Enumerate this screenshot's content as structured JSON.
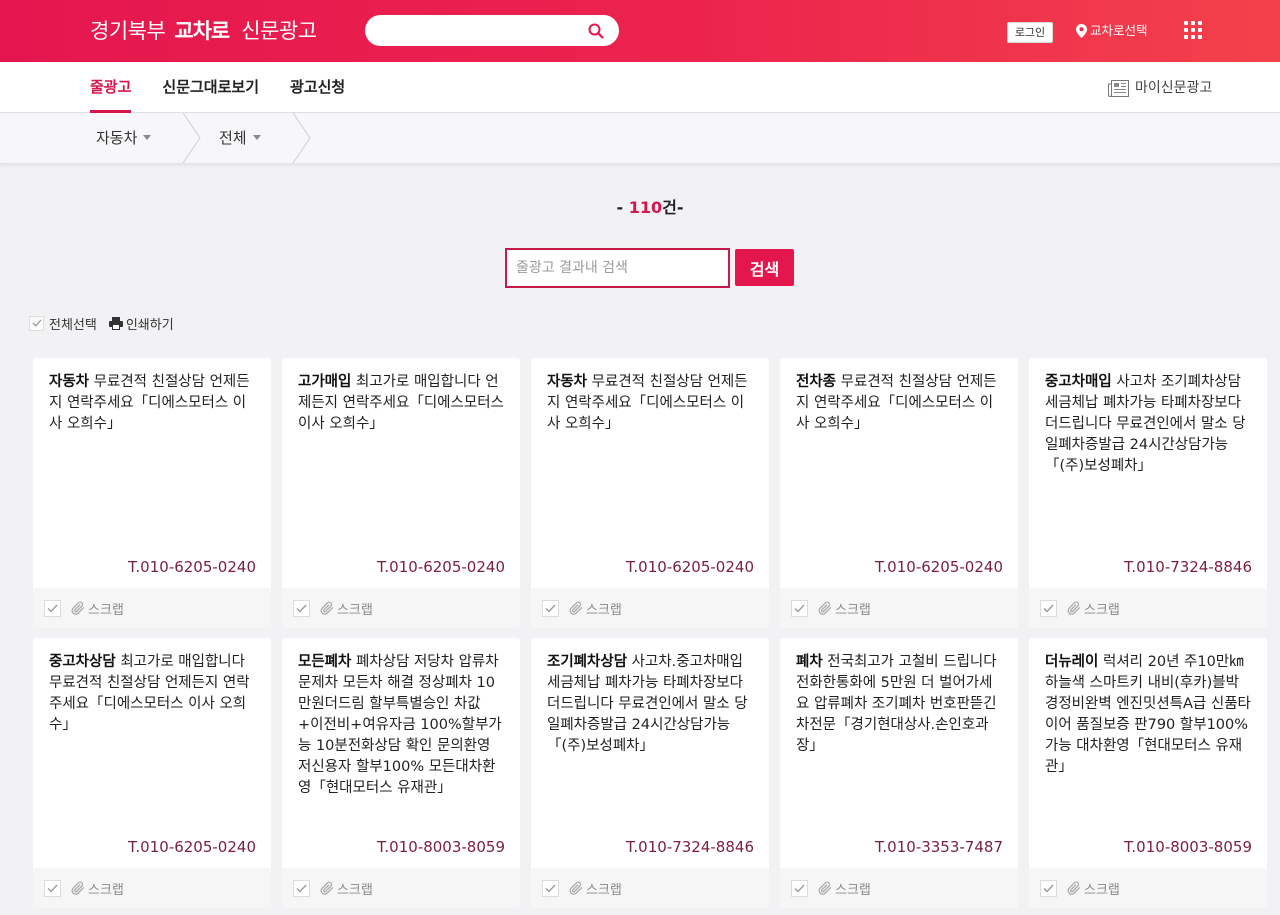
{
  "header": {
    "logo": {
      "region": "경기북부",
      "brand": "교차로",
      "service": "신문광고"
    },
    "search_value": "",
    "login_label": "로그인",
    "location_label": "교차로선택"
  },
  "nav": {
    "tabs": [
      {
        "label": "줄광고",
        "active": true
      },
      {
        "label": "신문그대로보기",
        "active": false
      },
      {
        "label": "광고신청",
        "active": false
      }
    ],
    "my_label": "마이신문광고"
  },
  "breadcrumb": [
    {
      "label": "자동차"
    },
    {
      "label": "전체"
    }
  ],
  "results": {
    "prefix": "- ",
    "count": "110",
    "suffix": "건-"
  },
  "filter": {
    "placeholder": "줄광고 결과내 검색",
    "button_label": "검색"
  },
  "actions": {
    "select_all": "전체선택",
    "print": "인쇄하기"
  },
  "card_footer": {
    "scrap_label": "스크랩"
  },
  "ads": [
    {
      "category": "자동차",
      "text": "무료견적 친절상담 언제든지 연락주세요「디에스모터스 이사 오희수」",
      "phone": "T.010-6205-0240"
    },
    {
      "category": "고가매입",
      "text": "최고가로 매입합니다 언제든지 연락주세요「디에스모터스 이사 오희수」",
      "phone": "T.010-6205-0240"
    },
    {
      "category": "자동차",
      "text": "무료견적 친절상담 언제든지 연락주세요「디에스모터스 이사 오희수」",
      "phone": "T.010-6205-0240"
    },
    {
      "category": "전차종",
      "text": "무료견적 친절상담 언제든지 연락주세요「디에스모터스 이사 오희수」",
      "phone": "T.010-6205-0240"
    },
    {
      "category": "중고차매입",
      "text": "사고차 조기폐차상담 세금체납 폐차가능 타폐차장보다 더드립니다 무료견인에서 말소 당일폐차증발급 24시간상담가능「(주)보성폐차」",
      "phone": "T.010-7324-8846"
    },
    {
      "category": "중고차상담",
      "text": "최고가로 매입합니다 무료견적 친절상담 언제든지 연락 주세요「디에스모터스 이사 오희수」",
      "phone": "T.010-6205-0240"
    },
    {
      "category": "모든폐차",
      "text": "폐차상담 저당차 압류차 문제차 모든차 해결 정상폐차 10만원더드림 할부특별승인 차값+이전비+여유자금 100%할부가능 10분전화상담 확인 문의환영 저신용자 할부100% 모든대차환영「현대모터스 유재관」",
      "phone": "T.010-8003-8059"
    },
    {
      "category": "조기폐차상담",
      "text": "사고차.중고차매입 세금체납 폐차가능 타폐차장보다 더드립니다 무료견인에서 말소 당일폐차증발급 24시간상담가능「(주)보성폐차」",
      "phone": "T.010-7324-8846"
    },
    {
      "category": "폐차",
      "text": "전국최고가 고철비 드립니다 전화한통화에 5만원 더 벌어가세요 압류폐차 조기폐차 번호판뜯긴차전문「경기현대상사.손인호과장」",
      "phone": "T.010-3353-7487"
    },
    {
      "category": "더뉴레이",
      "text": "럭셔리 20년 주10만㎞ 하늘색 스마트키 내비(후카)블박 경정비완벽 엔진밋션특A급 신품타이어 품질보증 판790 할부100%가능 대차환영「현대모터스 유재관」",
      "phone": "T.010-8003-8059"
    }
  ],
  "theme": {
    "accent": "#e3174d",
    "active_tab": "#d3174b",
    "phone_text": "#7a1f3f",
    "header_start": "#e5164f",
    "header_end": "#f3414b"
  }
}
